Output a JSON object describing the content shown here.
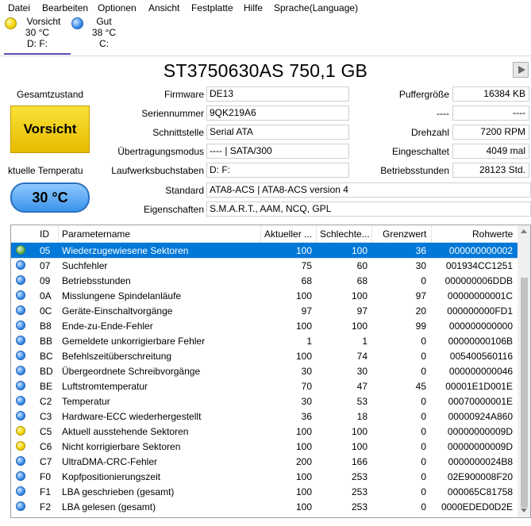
{
  "menu": [
    "Datei",
    "Bearbeiten",
    "Optionen",
    "Ansicht",
    "Festplatte",
    "Hilfe",
    "Sprache(Language)"
  ],
  "disks": [
    {
      "status": "Vorsicht",
      "temp": "30 °C",
      "letters": "D: F:",
      "color": "yellow"
    },
    {
      "status": "Gut",
      "temp": "38 °C",
      "letters": "C:",
      "color": "blue"
    }
  ],
  "drive_title": "ST3750630AS 750,1 GB",
  "health": {
    "label": "Gesamtzustand",
    "value": "Vorsicht"
  },
  "temperature": {
    "label": "ktuelle Temperatu",
    "value": "30 °C"
  },
  "info_left": [
    {
      "label": "Firmware",
      "value": "DE13"
    },
    {
      "label": "Seriennummer",
      "value": "9QK219A6"
    },
    {
      "label": "Schnittstelle",
      "value": "Serial ATA"
    },
    {
      "label": "Übertragungsmodus",
      "value": "---- | SATA/300"
    },
    {
      "label": "Laufwerksbuchstaben",
      "value": "D: F:"
    },
    {
      "label": "Standard",
      "value": "ATA8-ACS | ATA8-ACS version 4"
    },
    {
      "label": "Eigenschaften",
      "value": "S.M.A.R.T., AAM, NCQ, GPL"
    }
  ],
  "info_right": [
    {
      "label": "Puffergröße",
      "value": "16384 KB"
    },
    {
      "label": "----",
      "value": "----"
    },
    {
      "label": "Drehzahl",
      "value": "7200 RPM"
    },
    {
      "label": "Eingeschaltet",
      "value": "4049 mal"
    },
    {
      "label": "Betriebsstunden",
      "value": "28123 Std."
    }
  ],
  "table": {
    "headers": [
      "ID",
      "Parametername",
      "Aktueller ...",
      "Schlechte...",
      "Grenzwert",
      "Rohwerte"
    ],
    "rows": [
      {
        "dot": "green",
        "id": "05",
        "name": "Wiederzugewiesene Sektoren",
        "cur": "100",
        "worst": "100",
        "thr": "36",
        "raw": "000000000002"
      },
      {
        "dot": "blue",
        "id": "07",
        "name": "Suchfehler",
        "cur": "75",
        "worst": "60",
        "thr": "30",
        "raw": "001934CC1251"
      },
      {
        "dot": "blue",
        "id": "09",
        "name": "Betriebsstunden",
        "cur": "68",
        "worst": "68",
        "thr": "0",
        "raw": "000000006DDB"
      },
      {
        "dot": "blue",
        "id": "0A",
        "name": "Misslungene Spindelanläufe",
        "cur": "100",
        "worst": "100",
        "thr": "97",
        "raw": "00000000001C"
      },
      {
        "dot": "blue",
        "id": "0C",
        "name": "Geräte-Einschaltvorgänge",
        "cur": "97",
        "worst": "97",
        "thr": "20",
        "raw": "000000000FD1"
      },
      {
        "dot": "blue",
        "id": "B8",
        "name": "Ende-zu-Ende-Fehler",
        "cur": "100",
        "worst": "100",
        "thr": "99",
        "raw": "000000000000"
      },
      {
        "dot": "blue",
        "id": "BB",
        "name": "Gemeldete unkorrigierbare Fehler",
        "cur": "1",
        "worst": "1",
        "thr": "0",
        "raw": "00000000106B"
      },
      {
        "dot": "blue",
        "id": "BC",
        "name": "Befehlszeitüberschreitung",
        "cur": "100",
        "worst": "74",
        "thr": "0",
        "raw": "005400560116"
      },
      {
        "dot": "blue",
        "id": "BD",
        "name": "Übergeordnete Schreibvorgänge",
        "cur": "30",
        "worst": "30",
        "thr": "0",
        "raw": "000000000046"
      },
      {
        "dot": "blue",
        "id": "BE",
        "name": "Luftstromtemperatur",
        "cur": "70",
        "worst": "47",
        "thr": "45",
        "raw": "00001E1D001E"
      },
      {
        "dot": "blue",
        "id": "C2",
        "name": "Temperatur",
        "cur": "30",
        "worst": "53",
        "thr": "0",
        "raw": "00070000001E"
      },
      {
        "dot": "blue",
        "id": "C3",
        "name": "Hardware-ECC wiederhergestellt",
        "cur": "36",
        "worst": "18",
        "thr": "0",
        "raw": "00000924A860"
      },
      {
        "dot": "yellow",
        "id": "C5",
        "name": "Aktuell ausstehende Sektoren",
        "cur": "100",
        "worst": "100",
        "thr": "0",
        "raw": "00000000009D"
      },
      {
        "dot": "yellow",
        "id": "C6",
        "name": "Nicht korrigierbare Sektoren",
        "cur": "100",
        "worst": "100",
        "thr": "0",
        "raw": "00000000009D"
      },
      {
        "dot": "blue",
        "id": "C7",
        "name": "UltraDMA-CRC-Fehler",
        "cur": "200",
        "worst": "166",
        "thr": "0",
        "raw": "0000000024B8"
      },
      {
        "dot": "blue",
        "id": "F0",
        "name": "Kopfpositionierungszeit",
        "cur": "100",
        "worst": "253",
        "thr": "0",
        "raw": "02E900008F20"
      },
      {
        "dot": "blue",
        "id": "F1",
        "name": "LBA geschrieben (gesamt)",
        "cur": "100",
        "worst": "253",
        "thr": "0",
        "raw": "000065C81758"
      },
      {
        "dot": "blue",
        "id": "F2",
        "name": "LBA gelesen (gesamt)",
        "cur": "100",
        "worst": "253",
        "thr": "0",
        "raw": "0000EDED0D2E"
      }
    ]
  }
}
